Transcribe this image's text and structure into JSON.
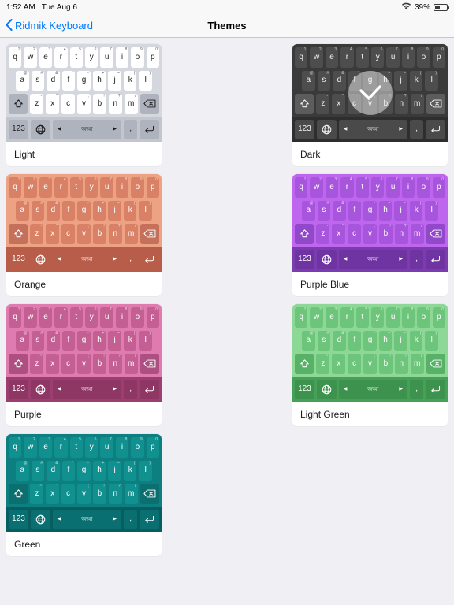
{
  "status_bar": {
    "time": "1:52 AM",
    "date": "Tue Aug 6",
    "battery_percent": "39%",
    "wifi_icon": "wifi-icon",
    "battery_icon": "battery-icon",
    "battery_level": 39
  },
  "nav": {
    "back_label": "Ridmik Keyboard",
    "back_icon": "chevron-left-icon",
    "title": "Themes",
    "accent_color": "#007aff"
  },
  "keyboard_layout": {
    "row1": [
      {
        "key": "q",
        "sup": "1"
      },
      {
        "key": "w",
        "sup": "2"
      },
      {
        "key": "e",
        "sup": "3"
      },
      {
        "key": "r",
        "sup": "4"
      },
      {
        "key": "t",
        "sup": "5"
      },
      {
        "key": "y",
        "sup": "6"
      },
      {
        "key": "u",
        "sup": "7"
      },
      {
        "key": "i",
        "sup": "8"
      },
      {
        "key": "o",
        "sup": "9"
      },
      {
        "key": "p",
        "sup": "0"
      }
    ],
    "row2": [
      {
        "key": "a",
        "sup": "@"
      },
      {
        "key": "s",
        "sup": "#"
      },
      {
        "key": "d",
        "sup": "&"
      },
      {
        "key": "f",
        "sup": "*"
      },
      {
        "key": "g",
        "sup": "-"
      },
      {
        "key": "h",
        "sup": "+"
      },
      {
        "key": "j",
        "sup": "="
      },
      {
        "key": "k",
        "sup": "("
      },
      {
        "key": "l",
        "sup": ")"
      }
    ],
    "row3": [
      {
        "key": "z",
        "sup": "~"
      },
      {
        "key": "x",
        "sup": "\""
      },
      {
        "key": "c",
        "sup": ":"
      },
      {
        "key": "v",
        "sup": ";"
      },
      {
        "key": "b",
        "sup": "!"
      },
      {
        "key": "n",
        "sup": "?"
      },
      {
        "key": "m",
        "sup": "/"
      }
    ],
    "shift_icon": "shift-icon",
    "backspace_icon": "backspace-icon",
    "numeric_label": "123",
    "globe_icon": "globe-icon",
    "space_label": "অআ",
    "space_arrow_left": "◀",
    "space_arrow_right": "▶",
    "comma_label": ",",
    "return_icon": "return-icon"
  },
  "themes": [
    {
      "name": "Light",
      "selected": false,
      "colors": {
        "bg": "#d4d7dd",
        "key": "#ffffff",
        "key_text": "#1c1c1e",
        "mod": "#aeb3bd",
        "mod_text": "#1c1c1e",
        "bottom_bg": "#c2c6ce",
        "bottom_key": "#aeb3bd",
        "bottom_text": "#1c1c1e"
      }
    },
    {
      "name": "Dark",
      "selected": true,
      "colors": {
        "bg": "#3a3a3a",
        "key": "#4d4d4d",
        "key_text": "#f2f2f2",
        "mod": "#5c5c5c",
        "mod_text": "#f2f2f2",
        "bottom_bg": "#2e2e2e",
        "bottom_key": "#4a4a4a",
        "bottom_text": "#f2f2f2"
      }
    },
    {
      "name": "Orange",
      "selected": false,
      "colors": {
        "bg": "#eda284",
        "key": "#d98167",
        "key_text": "#ffffff",
        "mod": "#c4705a",
        "mod_text": "#ffffff",
        "bottom_bg": "#b85d4a",
        "bottom_key": "#a8miss",
        "bottom_text": "#ffffff"
      }
    },
    {
      "name": "Purple Blue",
      "selected": false,
      "colors": {
        "bg": "#bf66ef",
        "key": "#a855dd",
        "key_text": "#ffffff",
        "mod": "#9148c9",
        "mod_text": "#ffffff",
        "bottom_bg": "#7b3cb0",
        "bottom_key": "#6f34a2",
        "bottom_text": "#ffffff"
      }
    },
    {
      "name": "Purple",
      "selected": false,
      "colors": {
        "bg": "#e07bb0",
        "key": "#c45f93",
        "key_text": "#ffffff",
        "mod": "#ad4f80",
        "mod_text": "#ffffff",
        "bottom_bg": "#9c3f70",
        "bottom_key": "#8e3664",
        "bottom_text": "#ffffff"
      }
    },
    {
      "name": "Light Green",
      "selected": false,
      "colors": {
        "bg": "#8ed897",
        "key": "#6dc47b",
        "key_text": "#ffffff",
        "mod": "#57b268",
        "mod_text": "#ffffff",
        "bottom_bg": "#46a057",
        "bottom_key": "#3d934e",
        "bottom_text": "#ffffff"
      }
    },
    {
      "name": "Green",
      "selected": false,
      "colors": {
        "bg": "#0d7f80",
        "key": "#10908f",
        "key_text": "#ffffff",
        "mod": "#0b6f70",
        "mod_text": "#ffffff",
        "bottom_bg": "#075d60",
        "bottom_key": "#0a6f71",
        "bottom_text": "#ffffff"
      }
    }
  ],
  "selected_theme_checkmark": "check-icon"
}
